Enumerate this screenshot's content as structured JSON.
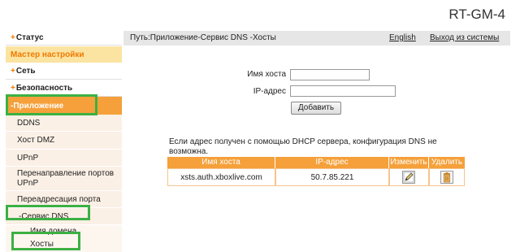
{
  "model": "RT-GM-4",
  "sidebar": {
    "status": "Статус",
    "wizard": "Мастер настройки",
    "network": "Сеть",
    "security": "Безопасность",
    "application": "-Приложение",
    "plus_sign": "+",
    "sub_items": [
      "DDNS",
      "Хост DMZ",
      "UPnP",
      "Перенаправление портов UPnP",
      "Переадресация порта"
    ],
    "dns_service": "-Сервис DNS",
    "dns_children": [
      "Имя домена",
      "Хосты"
    ]
  },
  "header": {
    "path": "Путь:Приложение-Сервис DNS -Хосты",
    "english": "English",
    "logout": "Выход из системы"
  },
  "form": {
    "hostname_label": "Имя хоста",
    "hostname_value": "",
    "ip_label": "IP-адрес",
    "ip_value": "",
    "add_button": "Добавить"
  },
  "note": "Если адрес получен с помощью DHCP сервера, конфигурация DNS не возможна.",
  "table": {
    "headers": [
      "Имя хоста",
      "IP-адрес",
      "Изменить",
      "Удалить"
    ],
    "rows": [
      {
        "host": "xsts.auth.xboxlive.com",
        "ip": "50.7.85.221"
      }
    ]
  },
  "colors": {
    "accent": "#f5a03a",
    "highlight": "#3cb043"
  }
}
